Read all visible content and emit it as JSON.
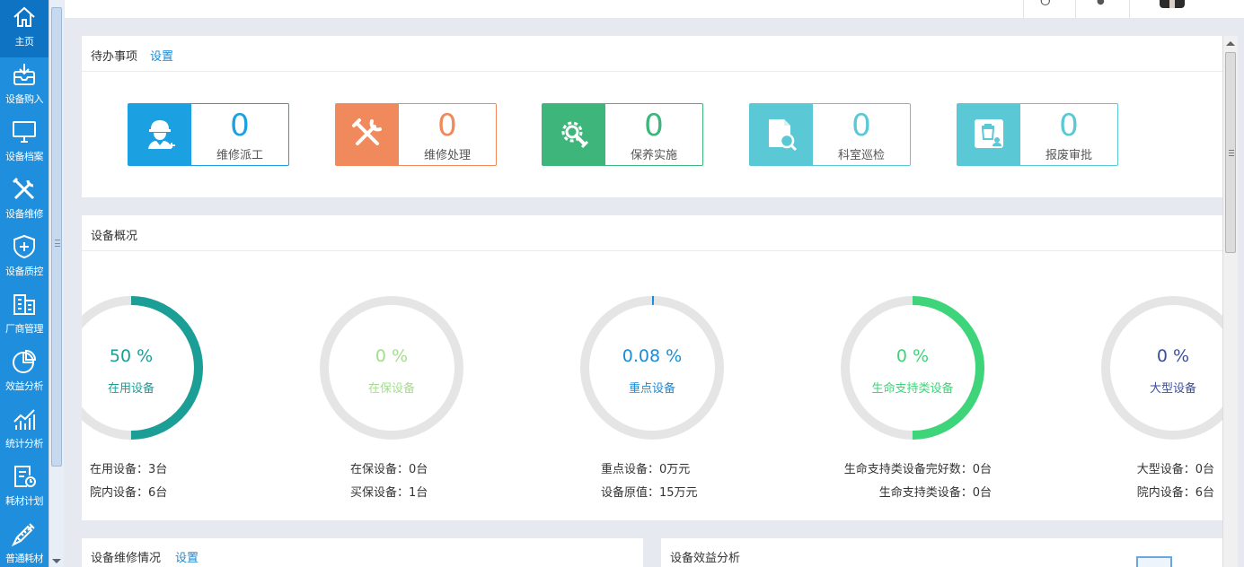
{
  "sidebar": {
    "items": [
      {
        "label": "主页",
        "icon": "home-icon"
      },
      {
        "label": "设备购入",
        "icon": "inbox-download-icon"
      },
      {
        "label": "设备档案",
        "icon": "monitor-icon"
      },
      {
        "label": "设备维修",
        "icon": "tools-icon"
      },
      {
        "label": "设备质控",
        "icon": "shield-plus-icon"
      },
      {
        "label": "厂商管理",
        "icon": "building-icon"
      },
      {
        "label": "效益分析",
        "icon": "pie-chart-icon"
      },
      {
        "label": "统计分析",
        "icon": "bar-trend-icon"
      },
      {
        "label": "耗材计划",
        "icon": "clipboard-clock-icon"
      },
      {
        "label": "普通耗材",
        "icon": "syringe-icon"
      }
    ]
  },
  "todo": {
    "title": "待办事项",
    "settings": "设置",
    "cards": [
      {
        "count": "0",
        "label": "维修派工",
        "color": "#1ba1e2",
        "icon": "engineer-icon"
      },
      {
        "count": "0",
        "label": "维修处理",
        "color": "#f0895c",
        "icon": "wrench-screwdriver-icon"
      },
      {
        "count": "0",
        "label": "保养实施",
        "color": "#3eb57a",
        "icon": "gear-wrench-icon"
      },
      {
        "count": "0",
        "label": "科室巡检",
        "color": "#5bc8d6",
        "icon": "document-search-icon"
      },
      {
        "count": "0",
        "label": "报废审批",
        "color": "#5bc8d6",
        "icon": "trash-user-icon"
      }
    ]
  },
  "overview": {
    "title": "设备概况",
    "gauges": [
      {
        "percent_text": "50 %",
        "name": "在用设备",
        "fraction": 0.5,
        "color": "#1a9e96",
        "stats": [
          "在用设备：3台",
          "院内设备：6台"
        ]
      },
      {
        "percent_text": "0 %",
        "name": "在保设备",
        "fraction": 0,
        "color": "#a5dd8f",
        "stats": [
          "在保设备：0台",
          "买保设备：1台"
        ]
      },
      {
        "percent_text": "0.08 %",
        "name": "重点设备",
        "fraction": 0.0008,
        "color": "#1b8bd6",
        "stats": [
          "重点设备：0万元",
          "设备原值：15万元"
        ]
      },
      {
        "percent_text": "0 %",
        "name": "生命支持类设备",
        "fraction": 0.5,
        "color": "#3ed47a",
        "stats": [
          "生命支持类设备完好数：0台",
          "生命支持类设备：0台"
        ]
      },
      {
        "percent_text": "0 %",
        "name": "大型设备",
        "fraction": 0,
        "color": "#3d4f9b",
        "stats": [
          "大型设备：0台",
          "院内设备：6台"
        ]
      }
    ]
  },
  "repair": {
    "title": "设备维修情况",
    "settings": "设置"
  },
  "benefit": {
    "title": "设备效益分析"
  }
}
